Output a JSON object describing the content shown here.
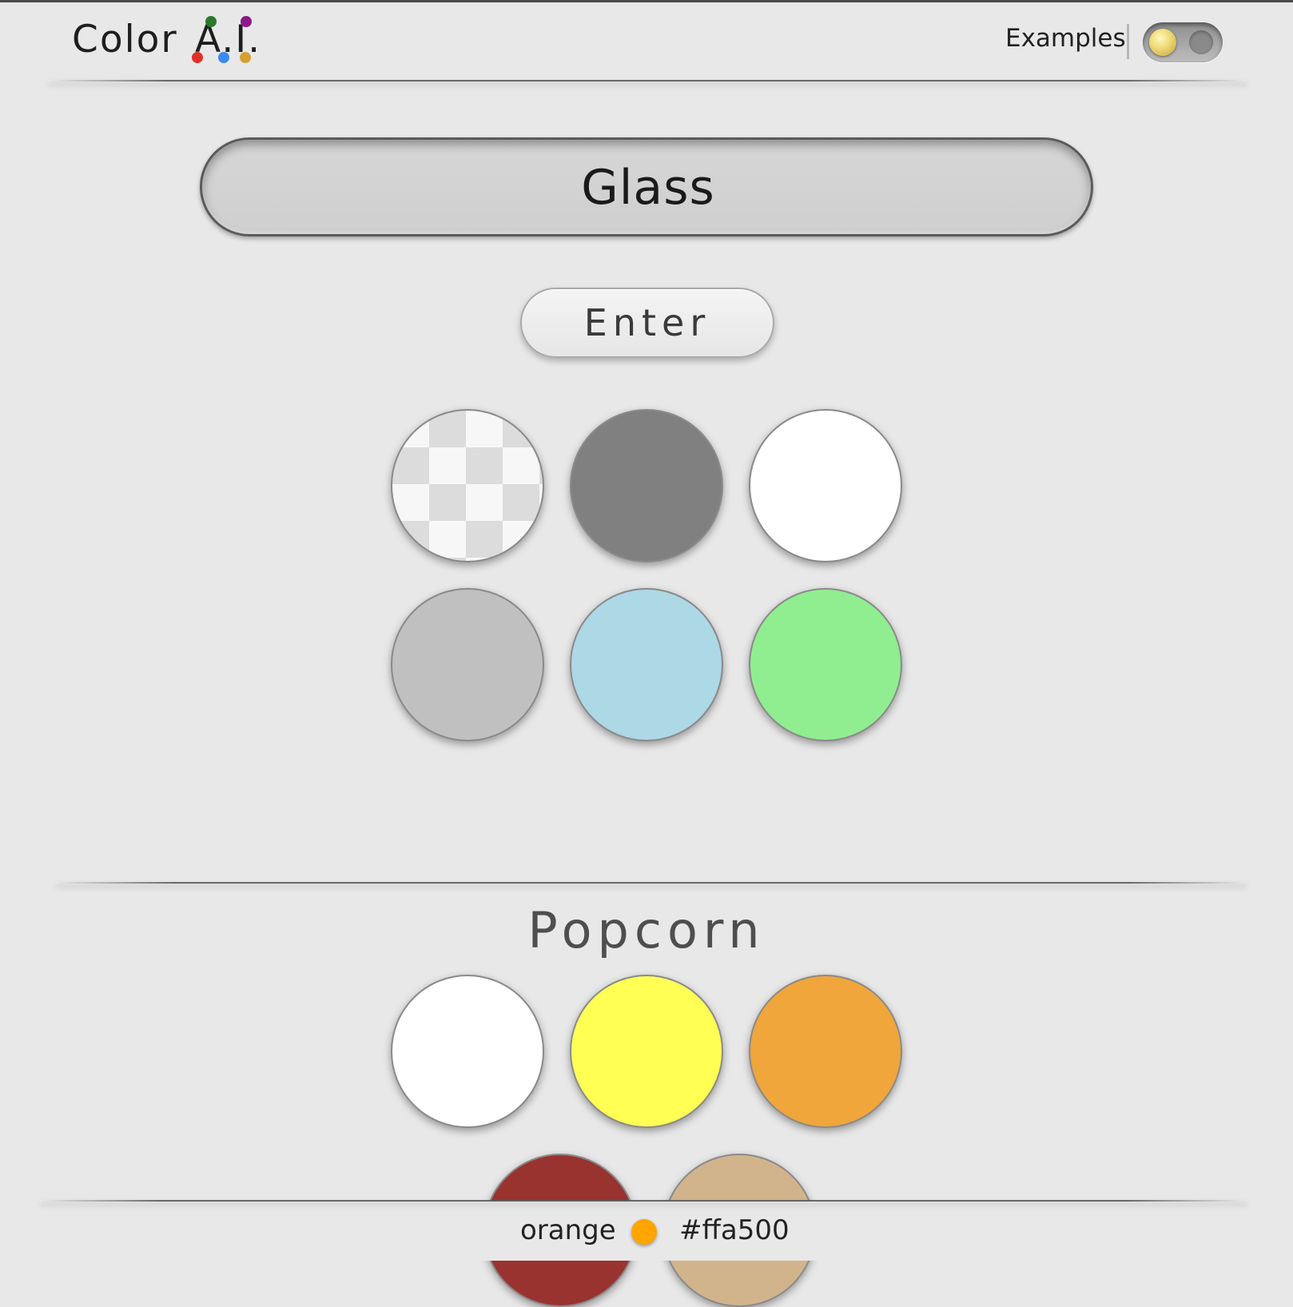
{
  "header": {
    "logo_word": "Color",
    "logo_ai": "A.I.",
    "logo_dot_colors": [
      "#2a7a2a",
      "#8a1a8a",
      "#e0302a",
      "#3a8af0",
      "#d6a030"
    ],
    "examples_label": "Examples",
    "examples_toggle_on": false
  },
  "search": {
    "value": "Glass"
  },
  "enter_button": {
    "label": "Enter"
  },
  "result_swatches": [
    {
      "color": "transparent",
      "pattern": "checkerboard"
    },
    {
      "color": "#808080"
    },
    {
      "color": "#ffffff"
    },
    {
      "color": "#c0c0c0"
    },
    {
      "color": "#add8e6"
    },
    {
      "color": "#90ee90"
    }
  ],
  "example": {
    "title": "Popcorn",
    "swatches": [
      {
        "color": "#ffffff"
      },
      {
        "color": "#ffff54"
      },
      {
        "color": "#f0a63a"
      },
      {
        "color": "#993330"
      },
      {
        "color": "#d2b48c"
      }
    ]
  },
  "footer": {
    "name": "orange",
    "swatch_color": "#ffa500",
    "hex": "#ffa500"
  }
}
